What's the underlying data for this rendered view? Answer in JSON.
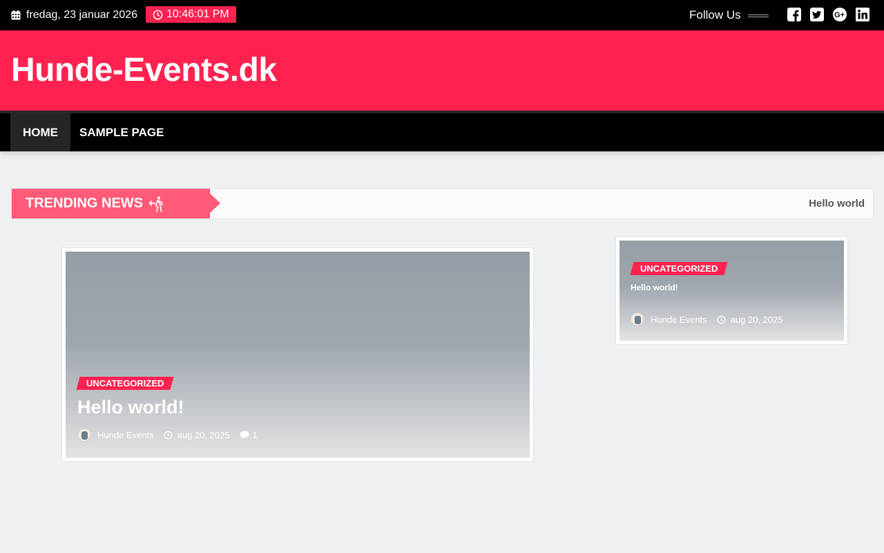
{
  "topbar": {
    "date": "fredag, 23 januar 2026",
    "time": "10:46:01 PM",
    "follow_label": "Follow Us",
    "socials": [
      "facebook-square-icon",
      "twitter-square-icon",
      "google-plus-icon",
      "linkedin-icon"
    ],
    "accent": "#ff2250"
  },
  "header": {
    "site_title": "Hunde-Events.dk",
    "background": "#ff2250"
  },
  "nav": {
    "items": [
      {
        "label": "HOME",
        "active": true
      },
      {
        "label": "SAMPLE PAGE",
        "active": false
      }
    ]
  },
  "trending": {
    "label": "TRENDING NEWS",
    "item": "Hello world"
  },
  "main_post": {
    "category": "UNCATEGORIZED",
    "title": "Hello world!",
    "author": "Hunde Events",
    "date": "aug 20, 2025",
    "comments": "1"
  },
  "side_post": {
    "category": "UNCATEGORIZED",
    "title": "Hello world!",
    "author": "Hunde Events",
    "date": "aug 20, 2025"
  }
}
